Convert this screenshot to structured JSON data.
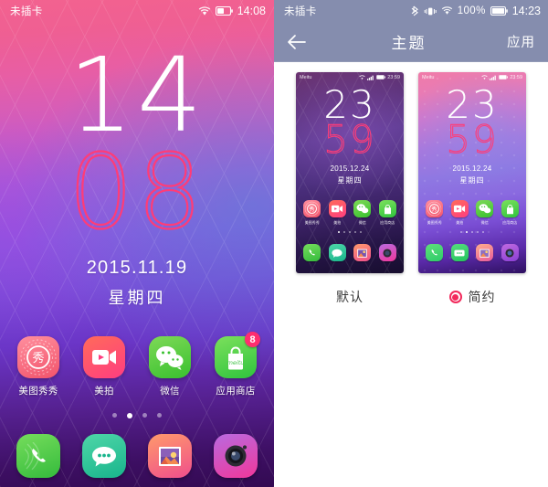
{
  "left_panel": {
    "statusbar": {
      "carrier": "未插卡",
      "time": "14:08",
      "icons": [
        "wifi-icon",
        "battery-icon"
      ]
    },
    "lockscreen": {
      "hour": "14",
      "minute": "08",
      "date": "2015.11.19",
      "weekday": "星期四"
    },
    "home_apps": [
      {
        "label": "美图秀秀",
        "icon": "meitu-xiuxiu-icon",
        "badge": ""
      },
      {
        "label": "美拍",
        "icon": "meipai-video-icon",
        "badge": ""
      },
      {
        "label": "微信",
        "icon": "wechat-icon",
        "badge": ""
      },
      {
        "label": "应用商店",
        "icon": "app-store-icon",
        "badge": "8"
      }
    ],
    "page_dots": {
      "count": 4,
      "active_index": 1
    },
    "dock_apps": [
      {
        "label": "电话",
        "icon": "phone-icon"
      },
      {
        "label": "信息",
        "icon": "messages-icon"
      },
      {
        "label": "相册",
        "icon": "gallery-icon"
      },
      {
        "label": "相机",
        "icon": "camera-icon"
      }
    ]
  },
  "right_panel": {
    "statusbar": {
      "carrier": "未插卡",
      "battery_percent": "100%",
      "time": "14:23",
      "icons": [
        "bluetooth-icon",
        "vibrate-icon",
        "wifi-icon",
        "battery-icon"
      ]
    },
    "header": {
      "back": "back-arrow-icon",
      "title": "主题",
      "apply_label": "应用"
    },
    "themes": [
      {
        "name": "默认",
        "selected": false,
        "preview": {
          "brand": "Meitu",
          "time": "23:59",
          "hour": "23",
          "minute": "59",
          "date": "2015.12.24",
          "weekday": "星期四",
          "apps": [
            "美图秀秀",
            "美拍",
            "微信",
            "应用商店"
          ],
          "page_dots": {
            "count": 5,
            "active_index": 0
          }
        }
      },
      {
        "name": "简约",
        "selected": true,
        "preview": {
          "brand": "Meitu",
          "time": "23:59",
          "hour": "23",
          "minute": "59",
          "date": "2015.12.24",
          "weekday": "星期四",
          "apps": [
            "美图秀秀",
            "美拍",
            "微信",
            "应用商店"
          ],
          "page_dots": {
            "count": 5,
            "active_index": 1
          }
        }
      }
    ]
  },
  "colors": {
    "accent_pink": "#f2295b",
    "clock_pink": "#ff3c77",
    "header_slate": "#858dae",
    "badge_red": "#ff2d6f"
  }
}
